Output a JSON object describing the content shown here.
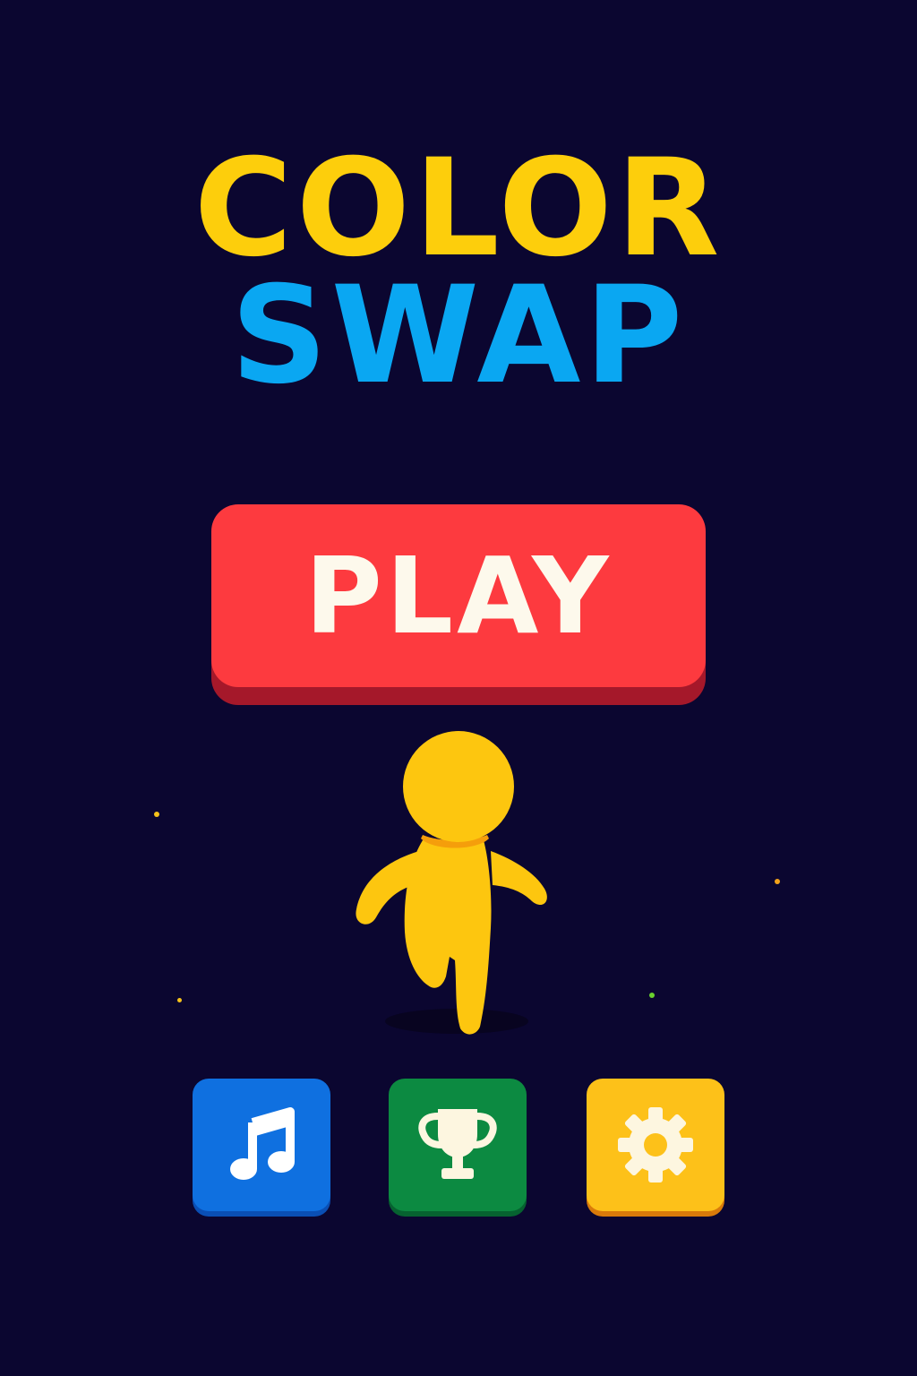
{
  "title": {
    "line1": "COLOR",
    "line2": "SWAP",
    "line1_color": "#fdce0c",
    "line2_color": "#0aa7f2"
  },
  "play_button": {
    "label": "PLAY",
    "color": "#fd3a3f"
  },
  "character": {
    "icon": "runner-character-icon",
    "color": "#fdc60f"
  },
  "bottom_buttons": [
    {
      "icon": "music-note-icon",
      "color": "#0f70e0"
    },
    {
      "icon": "trophy-icon",
      "color": "#0c8a41"
    },
    {
      "icon": "gear-icon",
      "color": "#fdc119"
    }
  ],
  "colors": {
    "background": "#0b0630"
  }
}
